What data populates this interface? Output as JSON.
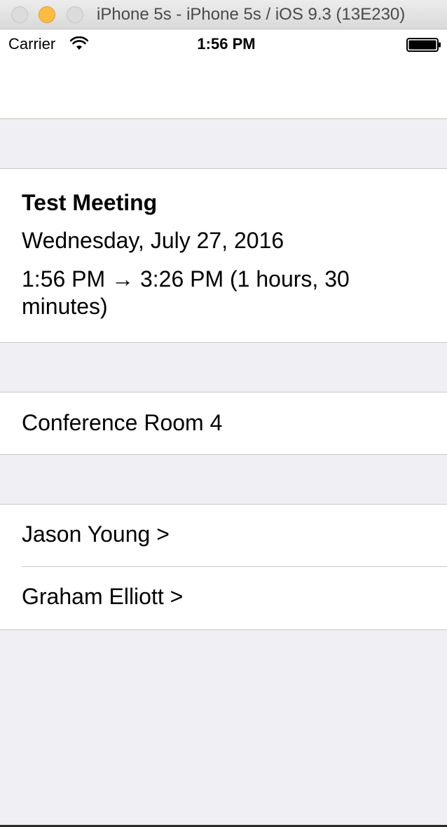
{
  "window": {
    "title": "iPhone 5s - iPhone 5s / iOS 9.3 (13E230)"
  },
  "status_bar": {
    "carrier": "Carrier",
    "time": "1:56 PM"
  },
  "event": {
    "title": "Test Meeting",
    "date": "Wednesday, July 27, 2016",
    "time_range": "1:56 PM → 3:26 PM (1 hours, 30 minutes)"
  },
  "location": {
    "name": "Conference Room 4"
  },
  "attendees": [
    {
      "label": "Jason Young >"
    },
    {
      "label": "Graham Elliott >"
    }
  ],
  "colors": {
    "grouped_background": "#efeff4",
    "separator": "#c8c7cc",
    "minimize_button": "#fdbc40"
  },
  "icons": {
    "signal": "wifi-icon",
    "battery": "battery-icon"
  }
}
